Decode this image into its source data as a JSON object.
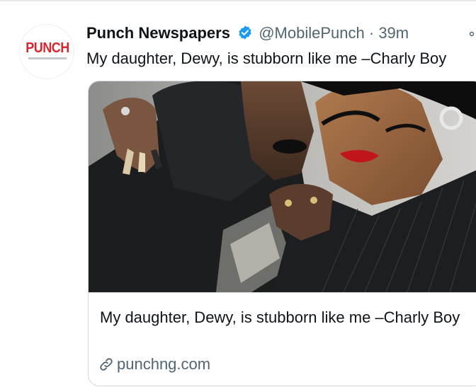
{
  "tweet": {
    "author_name": "Punch Newspapers",
    "handle": "@MobilePunch",
    "separator": "·",
    "time": "39m",
    "text": "My daughter, Dewy, is stubborn like me –Charly Boy"
  },
  "avatar": {
    "logo_text": "PUNCH",
    "brand_color": "#d8262e"
  },
  "card": {
    "title": "My daughter, Dewy, is stubborn like me –Charly Boy",
    "domain": "punchng.com",
    "image_description_icon": "photo"
  },
  "colors": {
    "verified": "#1d9bf0",
    "secondary_text": "#536471",
    "border": "#cfd9de"
  },
  "icons": {
    "verified": "verified-badge-icon",
    "link": "link-icon",
    "more": "more-icon"
  }
}
